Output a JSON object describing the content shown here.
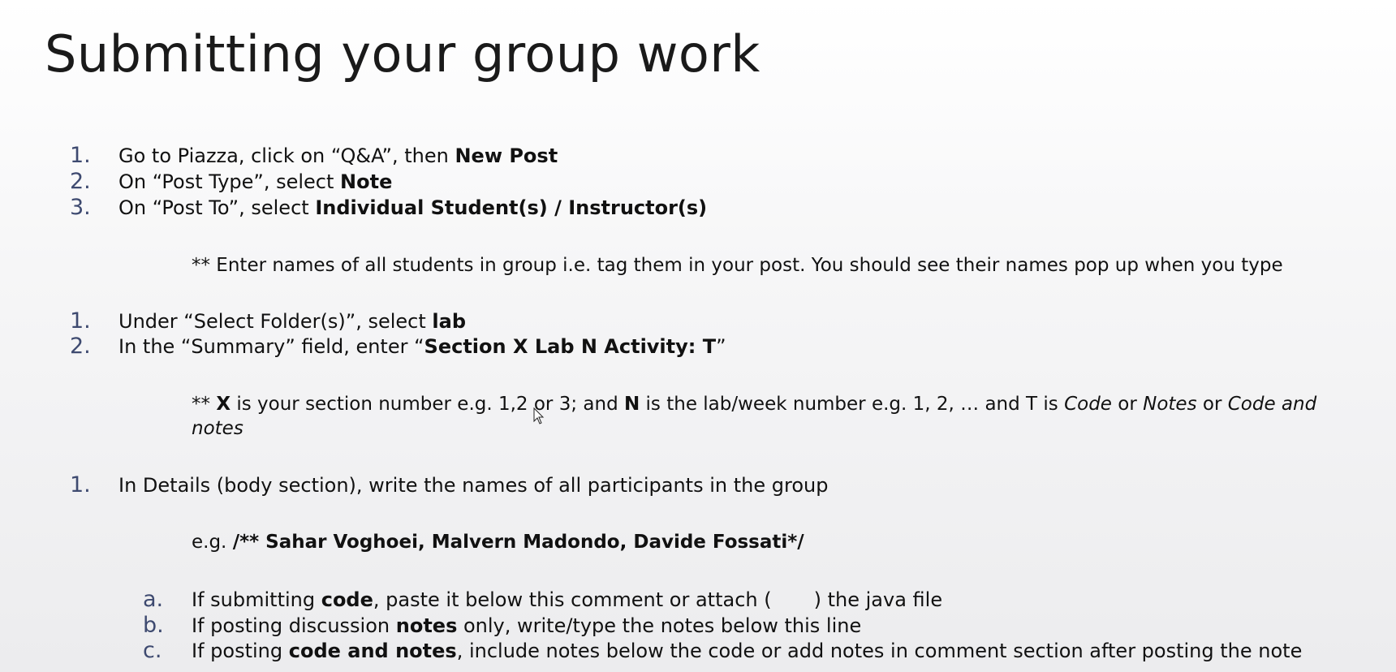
{
  "title": "Submitting your group work",
  "list1": [
    {
      "num": "1.",
      "pre": "Go to Piazza, click on “Q&A”, then ",
      "bold": "New Post",
      "post": ""
    },
    {
      "num": "2.",
      "pre": "On “Post Type”, select ",
      "bold": "Note",
      "post": ""
    },
    {
      "num": "3.",
      "pre": "On “Post To”, select ",
      "bold": "Individual Student(s) / Instructor(s)",
      "post": ""
    }
  ],
  "note1": "** Enter names of all students in group i.e. tag them in your post. You should see their names pop up when you type",
  "list2": [
    {
      "num": "1.",
      "pre": "Under “Select Folder(s)”, select ",
      "bold": "lab",
      "post": ""
    },
    {
      "num": "2.",
      "pre": "In the “Summary” field, enter “",
      "bold": "Section X Lab N Activity: T",
      "post": "”"
    }
  ],
  "note2": {
    "p1": "** ",
    "b1": "X",
    "p2": " is your section number e.g. 1,2 or 3; and ",
    "b2": "N",
    "p3": " is the lab/week number e.g. 1, 2, … and T is ",
    "i1": "Code",
    "p4": " or ",
    "i2": "Notes",
    "p5": " or ",
    "i3": "Code and",
    "line2": "notes"
  },
  "list3": [
    {
      "num": "1.",
      "text": "In Details (body section), write the names of all participants in the group"
    }
  ],
  "example": {
    "pre": "e.g. ",
    "bold": "/** Sahar Voghoei, Malvern Madondo, Davide Fossati*/"
  },
  "sublist": [
    {
      "letter": "a.",
      "pre": "If submitting ",
      "bold": "code",
      "mid": ", paste it below this comment or attach (",
      "post": ") the java file"
    },
    {
      "letter": "b.",
      "pre": "If posting discussion ",
      "bold": "notes",
      "mid": " only, write/type the notes below this line",
      "post": ""
    },
    {
      "letter": "c.",
      "pre": "If posting ",
      "bold": "code and notes",
      "mid": ", include notes below the code or add notes in comment section after posting the note",
      "post": ""
    }
  ],
  "colors": {
    "numbering": "#3e4a70",
    "text": "#111111"
  },
  "icons": {
    "cursor": "mouse-pointer-icon"
  }
}
